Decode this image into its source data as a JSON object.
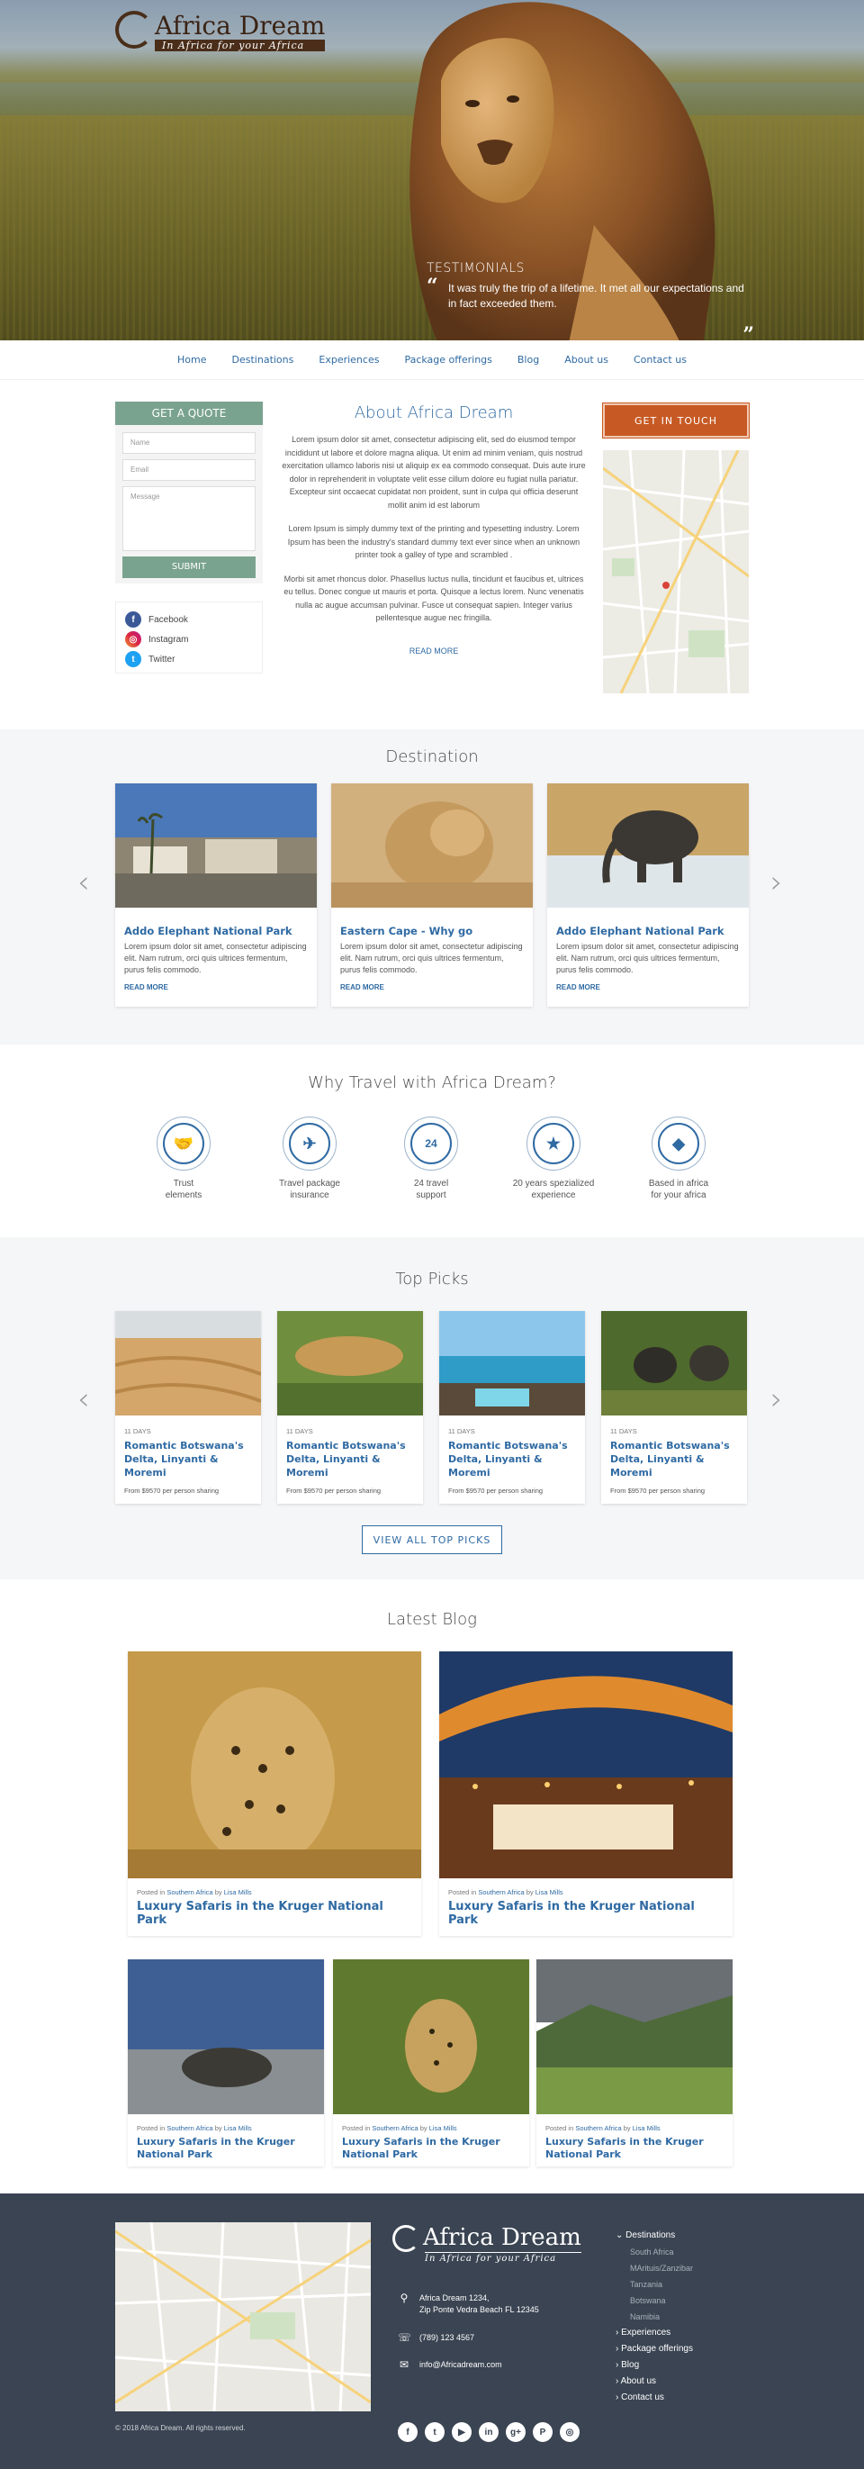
{
  "brand": {
    "name_part1": "Africa",
    "name_part2": " Dream",
    "tagline": "In Africa for your Africa"
  },
  "hero": {
    "testimonial_heading": "TESTIMONIALS",
    "testimonial_text": "It was truly the trip of a lifetime. It met all our expectations and in fact exceeded them."
  },
  "nav": [
    "Home",
    "Destinations",
    "Experiences",
    "Package offerings",
    "Blog",
    "About us",
    "Contact us"
  ],
  "quote_form": {
    "title": "GET A QUOTE",
    "name_placeholder": "Name",
    "email_placeholder": "Email",
    "message_placeholder": "Message",
    "submit": "SUBMIT"
  },
  "social": [
    "Facebook",
    "Instagram",
    "Twitter"
  ],
  "about": {
    "title": "About Africa Dream",
    "p1": "Lorem ipsum dolor sit amet, consectetur adipiscing elit, sed do eiusmod tempor incididunt ut labore et dolore magna aliqua. Ut enim ad minim veniam, quis nostrud exercitation ullamco laboris nisi ut aliquip ex ea commodo consequat. Duis aute irure dolor in reprehenderit in voluptate velit esse cillum dolore eu fugiat nulla pariatur. Excepteur sint occaecat cupidatat non proident, sunt in culpa qui officia deserunt mollit anim id est laborum",
    "p2": "Lorem Ipsum is simply dummy text of the printing and typesetting industry. Lorem Ipsum has been the industry's standard dummy text ever since when an unknown printer took a galley of type and scrambled .",
    "p3": "Morbi sit amet rhoncus dolor. Phasellus luctus nulla, tincidunt et faucibus et, ultrices eu tellus. Donec congue ut mauris et porta. Quisque a lectus lorem. Nunc venenatis nulla ac augue accumsan pulvinar. Fusce ut consequat sapien. Integer varius pellentesque augue nec fringilla.",
    "read_more": "READ MORE",
    "get_in_touch": "GET IN TOUCH"
  },
  "destination": {
    "title": "Destination",
    "cards": [
      {
        "title": "Addo Elephant National Park",
        "text": "Lorem ipsum dolor sit amet, consectetur adipiscing elit. Nam rutrum, orci quis ultrices fermentum, purus felis commodo.",
        "more": "READ MORE"
      },
      {
        "title": "Eastern Cape - Why go",
        "text": "Lorem ipsum dolor sit amet, consectetur adipiscing elit. Nam rutrum, orci quis ultrices fermentum, purus felis commodo.",
        "more": "READ MORE"
      },
      {
        "title": "Addo Elephant National Park",
        "text": "Lorem ipsum dolor sit amet, consectetur adipiscing elit. Nam rutrum, orci quis ultrices fermentum, purus felis commodo.",
        "more": "READ MORE"
      }
    ]
  },
  "why": {
    "title": "Why Travel with Africa Dream?",
    "features": [
      {
        "icon": "handshake-icon",
        "l1": "Trust",
        "l2": "elements"
      },
      {
        "icon": "airplane-icon",
        "l1": "Travel package",
        "l2": "insurance"
      },
      {
        "icon": "24-hour-icon",
        "l1": "24 travel",
        "l2": "support"
      },
      {
        "icon": "award-shield-icon",
        "l1": "20 years spezialized",
        "l2": "experience"
      },
      {
        "icon": "africa-map-icon",
        "l1": "Based in africa",
        "l2": "for your africa"
      }
    ]
  },
  "picks": {
    "title": "Top Picks",
    "view_all": "VIEW ALL TOP PICKS",
    "items": [
      {
        "days": "11 DAYS",
        "title": "Romantic Botswana's Delta, Linyanti & Moremi",
        "price": "From $9570 per person sharing"
      },
      {
        "days": "11 DAYS",
        "title": "Romantic Botswana's Delta, Linyanti & Moremi",
        "price": "From $9570 per person sharing"
      },
      {
        "days": "11 DAYS",
        "title": "Romantic Botswana's Delta, Linyanti & Moremi",
        "price": "From $9570 per person sharing"
      },
      {
        "days": "11 DAYS",
        "title": "Romantic Botswana's Delta, Linyanti & Moremi",
        "price": "From $9570 per person sharing"
      }
    ]
  },
  "blog": {
    "title": "Latest Blog",
    "posted_in": "Posted in",
    "category": "Southern Africa",
    "by": "by",
    "author": "Lisa Mills",
    "post_title": "Luxury Safaris in the Kruger National Park"
  },
  "footer": {
    "address1": "Africa Dream 1234,",
    "address2": "Zip Ponte Vedra Beach FL 12345",
    "phone": "(789) 123 4567",
    "email": "info@Africadream.com",
    "copyright": "© 2018 Africa Dream. All rights reserved.",
    "links": {
      "destinations": "Destinations",
      "sub": [
        "South Africa",
        "MArituis/Zanzibar",
        "Tanzania",
        "Botswana",
        "Namibia"
      ],
      "experiences": "Experiences",
      "package": "Package offerings",
      "blog": "Blog",
      "about": "About us",
      "contact": "Contact us"
    }
  }
}
